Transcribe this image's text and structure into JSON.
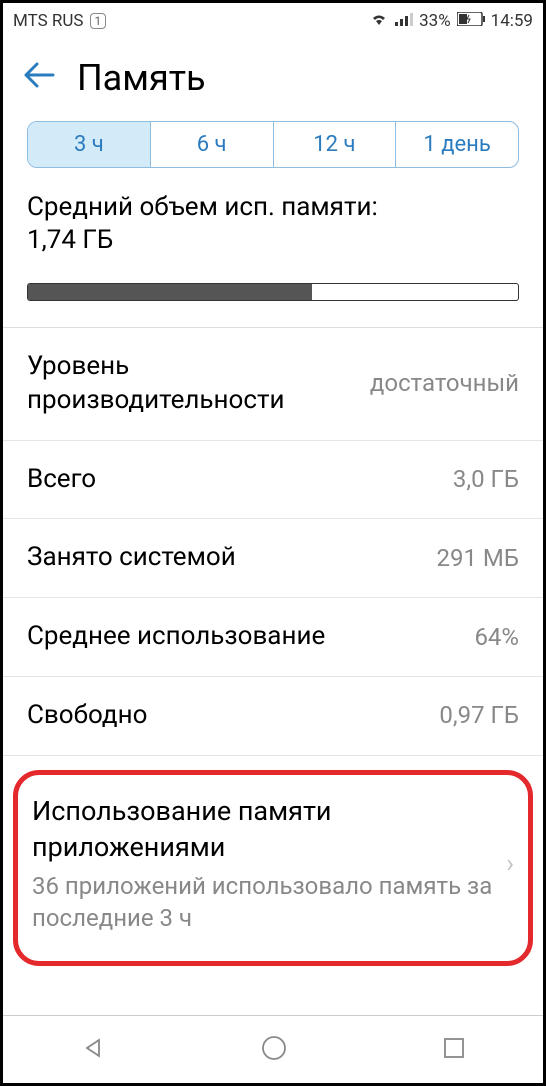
{
  "status": {
    "carrier": "MTS RUS",
    "sim": "1",
    "battery_pct": "33%",
    "time": "14:59"
  },
  "header": {
    "title": "Память"
  },
  "tabs": [
    {
      "label": "3 ч",
      "active": true
    },
    {
      "label": "6 ч",
      "active": false
    },
    {
      "label": "12 ч",
      "active": false
    },
    {
      "label": "1 день",
      "active": false
    }
  ],
  "avg": {
    "label": "Средний объем исп. памяти:",
    "value": "1,74 ГБ",
    "fill_pct": 58
  },
  "rows": [
    {
      "label": "Уровень производительности",
      "value": "достаточный"
    },
    {
      "label": "Всего",
      "value": "3,0 ГБ"
    },
    {
      "label": "Занято системой",
      "value": "291 МБ"
    },
    {
      "label": "Среднее использование",
      "value": "64%"
    },
    {
      "label": "Свободно",
      "value": "0,97 ГБ"
    }
  ],
  "highlight": {
    "title": "Использование памяти приложениями",
    "subtitle": "36 приложений использовало память за последние 3 ч"
  }
}
